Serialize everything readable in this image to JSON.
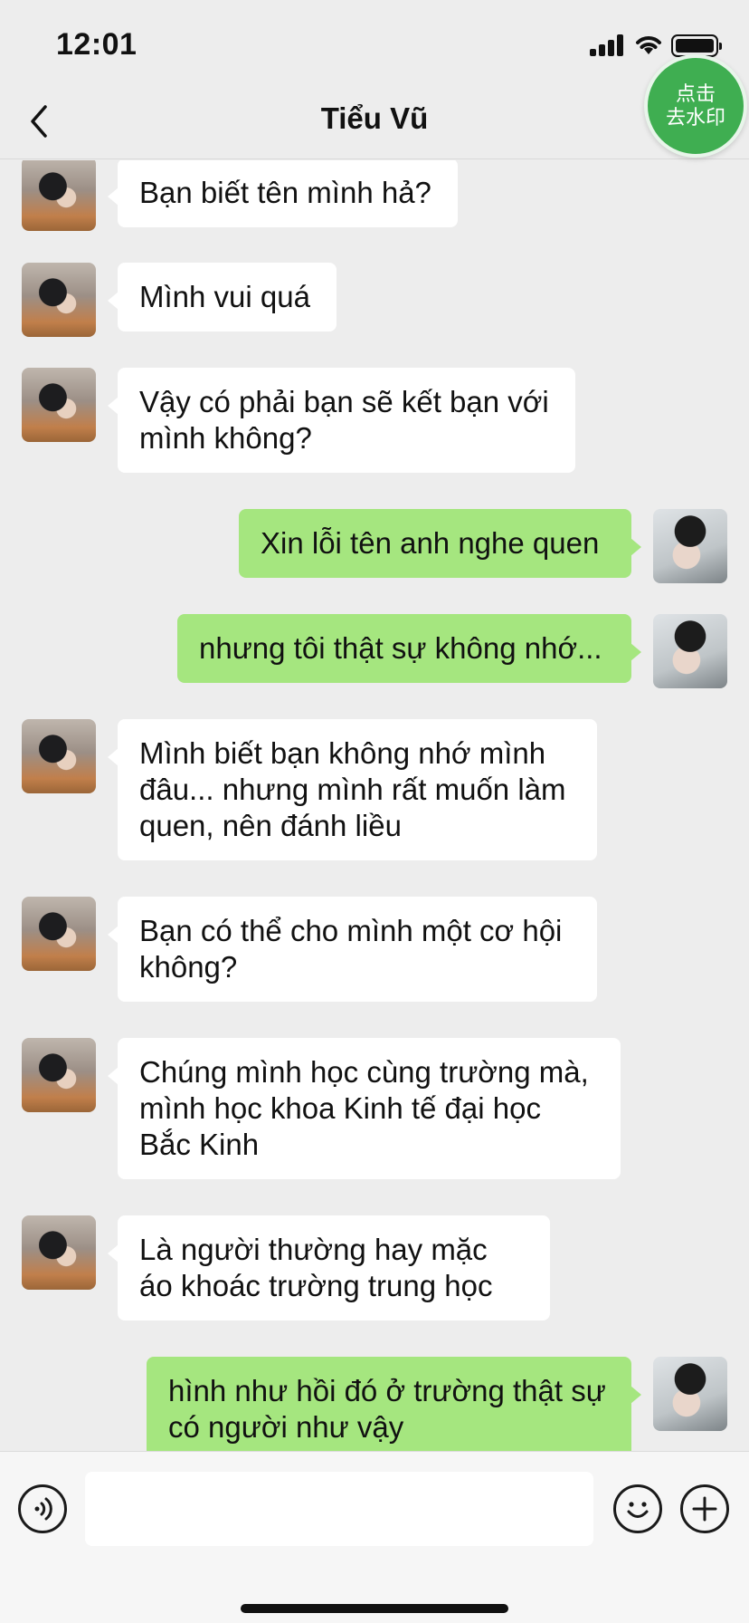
{
  "status_bar": {
    "time": "12:01"
  },
  "nav": {
    "title": "Tiểu Vũ",
    "badge": "点击 去水印"
  },
  "messages": [
    {
      "side": "in",
      "text": "Bạn biết tên mình hả?"
    },
    {
      "side": "in",
      "text": "Mình vui quá"
    },
    {
      "side": "in",
      "text": "Vậy có phải bạn sẽ kết bạn với mình không?"
    },
    {
      "side": "out",
      "text": "Xin lỗi tên anh nghe quen"
    },
    {
      "side": "out",
      "text": "nhưng tôi thật sự không nhớ..."
    },
    {
      "side": "in",
      "text": "Mình biết bạn không nhớ mình đâu... nhưng mình rất muốn làm quen, nên đánh liều"
    },
    {
      "side": "in",
      "text": "Bạn có thể cho mình một cơ hội không?"
    },
    {
      "side": "in",
      "text": "Chúng mình học cùng trường mà, mình học khoa Kinh tế đại học Bắc Kinh"
    },
    {
      "side": "in",
      "text": "Là người thường hay mặc áo khoác trường trung học"
    },
    {
      "side": "out",
      "text": "hình như hồi đó ở trường thật sự có người như vậy"
    }
  ],
  "icons": {
    "back": "chevron-left-icon",
    "voice": "voice-icon",
    "emoji": "emoji-icon",
    "plus": "plus-icon"
  },
  "colors": {
    "outgoing_bubble": "#a5e67f",
    "incoming_bubble": "#ffffff",
    "background": "#ededed",
    "badge": "#3fae51"
  }
}
